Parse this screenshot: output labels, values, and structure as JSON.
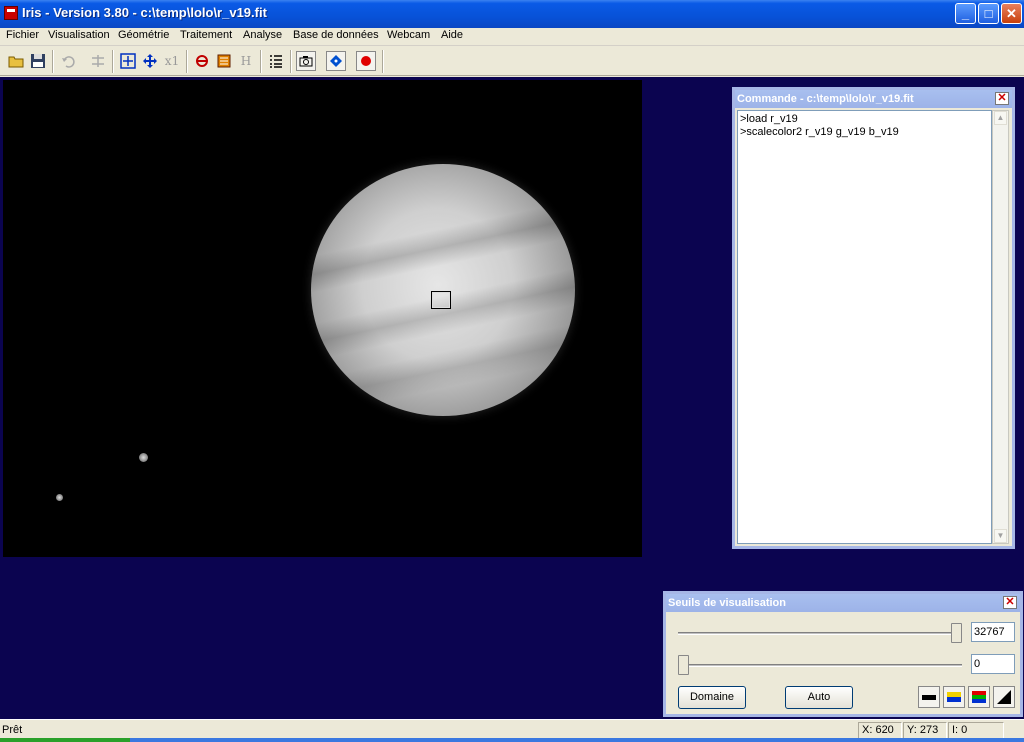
{
  "window": {
    "title": "Iris - Version 3.80 - c:\\temp\\lolo\\r_v19.fit",
    "minimize": "_",
    "maximize": "□",
    "close": "✕"
  },
  "menu": [
    "Fichier",
    "Visualisation",
    "Géométrie",
    "Traitement",
    "Analyse",
    "Base de données",
    "Webcam",
    "Aide"
  ],
  "toolbar": {
    "icons": [
      "open-folder-icon",
      "save-icon",
      "undo-icon",
      "flip-icon",
      "zoom-fit-icon",
      "move-icon",
      "zoom-x1-icon",
      "rotate-icon",
      "stack-icon",
      "histogram-icon",
      "list-icon",
      "camera-icon",
      "diamond-icon",
      "record-icon"
    ],
    "x1_label": "x1",
    "h_label": "H"
  },
  "command_panel": {
    "title": "Commande - c:\\temp\\lolo\\r_v19.fit",
    "lines": [
      ">load r_v19",
      ">scalecolor2 r_v19 g_v19 b_v19"
    ]
  },
  "threshold_panel": {
    "title": "Seuils de visualisation",
    "high_value": "32767",
    "low_value": "0",
    "high_slider_level": 1.0,
    "low_slider_level": 0.0,
    "domaine_label": "Domaine",
    "auto_label": "Auto"
  },
  "status": {
    "text": "Prêt",
    "x": "X: 620",
    "y": "Y: 273",
    "i": "I: 0"
  }
}
